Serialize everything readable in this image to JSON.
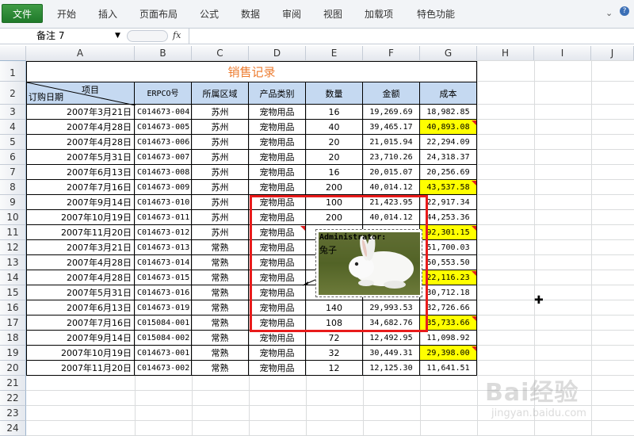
{
  "ribbon": {
    "file_tab": "文件",
    "tabs": [
      "开始",
      "插入",
      "页面布局",
      "公式",
      "数据",
      "审阅",
      "视图",
      "加载项",
      "特色功能"
    ]
  },
  "formula_bar": {
    "name_box": "备注 7",
    "fx_label": "fx",
    "formula": ""
  },
  "columns": [
    "A",
    "B",
    "C",
    "D",
    "E",
    "F",
    "G",
    "H",
    "I",
    "J"
  ],
  "rows": [
    "1",
    "2",
    "3",
    "4",
    "5",
    "6",
    "7",
    "8",
    "9",
    "10",
    "11",
    "12",
    "13",
    "14",
    "15",
    "16",
    "17",
    "18",
    "19",
    "20",
    "21",
    "22",
    "23",
    "24",
    "25"
  ],
  "sheet": {
    "title": "销售记录",
    "header_diag_top": "项目",
    "header_diag_bottom": "订购日期",
    "headers": [
      "ERPCO号",
      "所属区域",
      "产品类别",
      "数量",
      "金额",
      "成本"
    ],
    "data": [
      [
        "2007年3月21日",
        "C014673-004",
        "苏州",
        "宠物用品",
        "16",
        "19,269.69",
        "18,982.85"
      ],
      [
        "2007年4月28日",
        "C014673-005",
        "苏州",
        "宠物用品",
        "40",
        "39,465.17",
        "40,893.08"
      ],
      [
        "2007年4月28日",
        "C014673-006",
        "苏州",
        "宠物用品",
        "20",
        "21,015.94",
        "22,294.09"
      ],
      [
        "2007年5月31日",
        "C014673-007",
        "苏州",
        "宠物用品",
        "20",
        "23,710.26",
        "24,318.37"
      ],
      [
        "2007年6月13日",
        "C014673-008",
        "苏州",
        "宠物用品",
        "16",
        "20,015.07",
        "20,256.69"
      ],
      [
        "2007年7月16日",
        "C014673-009",
        "苏州",
        "宠物用品",
        "200",
        "40,014.12",
        "43,537.58"
      ],
      [
        "2007年9月14日",
        "C014673-010",
        "苏州",
        "宠物用品",
        "100",
        "21,423.95",
        "22,917.34"
      ],
      [
        "2007年10月19日",
        "C014673-011",
        "苏州",
        "宠物用品",
        "200",
        "40,014.12",
        "44,253.36"
      ],
      [
        "2007年11月20日",
        "C014673-012",
        "苏州",
        "宠物用品",
        "",
        "",
        "92,301.15"
      ],
      [
        "2007年3月21日",
        "C014673-013",
        "常熟",
        "宠物用品",
        "",
        "",
        "51,700.03"
      ],
      [
        "2007年4月28日",
        "C014673-014",
        "常熟",
        "宠物用品",
        "",
        "",
        "50,553.50"
      ],
      [
        "2007年4月28日",
        "C014673-015",
        "常熟",
        "宠物用品",
        "",
        "",
        "22,116.23"
      ],
      [
        "2007年5月31日",
        "C014673-016",
        "常熟",
        "宠物用品",
        "",
        "",
        "30,712.18"
      ],
      [
        "2007年6月13日",
        "C014673-019",
        "常熟",
        "宠物用品",
        "140",
        "29,993.53",
        "32,726.66"
      ],
      [
        "2007年7月16日",
        "C015084-001",
        "常熟",
        "宠物用品",
        "108",
        "34,682.76",
        "35,733.66"
      ],
      [
        "2007年9月14日",
        "C015084-002",
        "常熟",
        "宠物用品",
        "72",
        "12,492.95",
        "11,098.92"
      ],
      [
        "2007年10月19日",
        "C014673-001",
        "常熟",
        "宠物用品",
        "32",
        "30,449.31",
        "29,398.00"
      ],
      [
        "2007年11月20日",
        "C014673-002",
        "常熟",
        "宠物用品",
        "12",
        "12,125.30",
        "11,641.51"
      ]
    ],
    "highlight_rows": [
      1,
      5,
      8,
      11,
      14,
      16
    ]
  },
  "comment": {
    "author": "Administrator:",
    "text": "兔子"
  },
  "watermark": {
    "logo": "Bai经验",
    "url": "jingyan.baidu.com"
  },
  "colors": {
    "title": "#ed7d31",
    "header_bg": "#c5d9f1",
    "highlight_cell": "#ffff00",
    "red_box": "#e81b1b",
    "file_tab": "#2a8a33"
  }
}
